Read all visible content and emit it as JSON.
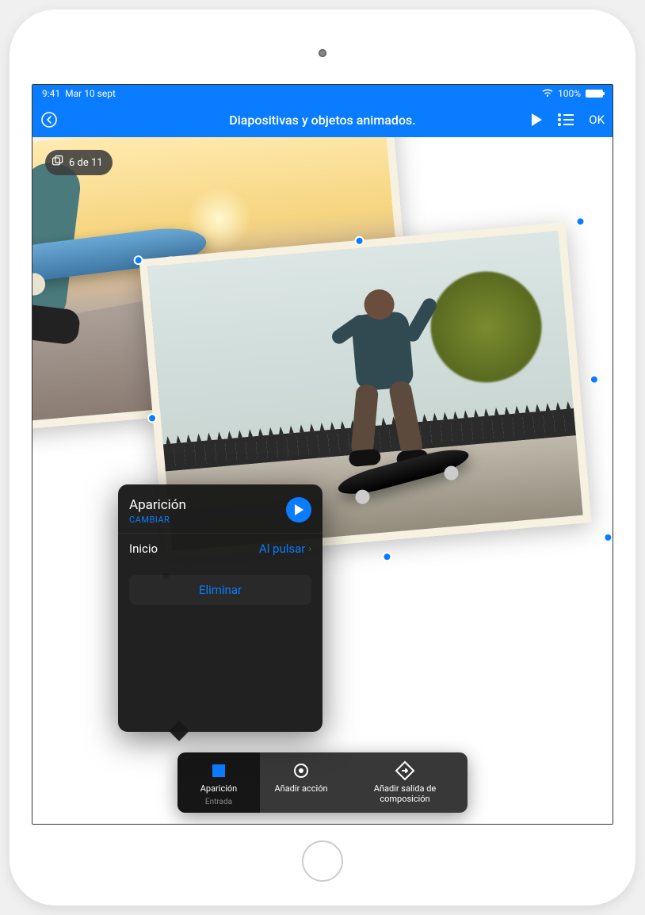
{
  "status": {
    "time": "9:41",
    "date": "Mar 10 sept",
    "battery_pct": "100%"
  },
  "header": {
    "title": "Diapositivas y objetos animados.",
    "ok": "OK"
  },
  "slide_counter": "6 de 11",
  "popover": {
    "title": "Aparición",
    "change": "CAMBIAR",
    "start_label": "Inicio",
    "start_value": "Al pulsar",
    "delete": "Eliminar"
  },
  "toolbar": {
    "item1_label": "Aparición",
    "item1_sub": "Entrada",
    "item2_label": "Añadir acción",
    "item3_label": "Añadir salida de composición"
  }
}
